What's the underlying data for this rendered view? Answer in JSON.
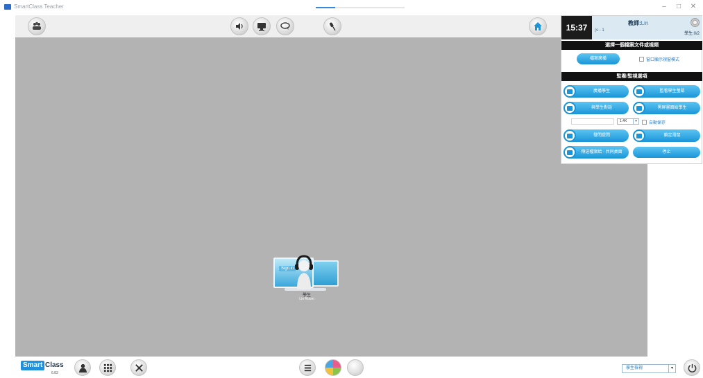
{
  "titlebar": {
    "title": "SmartClass Teacher",
    "progress_fraction": 0.22,
    "minimize": "–",
    "maximize": "□",
    "close": "✕"
  },
  "toolbar": {
    "icons": [
      "students-group-icon",
      "speaker-icon",
      "monitor-icon",
      "chat-icon",
      "microphone-icon",
      "home-icon"
    ]
  },
  "panel": {
    "clock": "15:37",
    "class_id": "(s - 1",
    "teacher_prefix": "教師:",
    "teacher_name": "Lin",
    "student_count": "學生:0/2",
    "section1_title": "選擇一個檔案文件或視頻",
    "open_file_button": "檔案廣播",
    "checkbox_window_mode": "窗口顯示視窗模式",
    "section2_title": "監看/監視選項",
    "buttons": {
      "broadcast_student": "廣播學生",
      "monitor_student_screen": "監看學生螢幕",
      "talk_to_student": "與學生對話",
      "black_screen_student": "黑屏畫面給學生",
      "ask_question": "發問提問",
      "lock_mouse": "鎖定滑鼠",
      "send_ppt": "傳送檔案給 - 共同桌面",
      "stop": "停止"
    },
    "select_small": "1.4K",
    "checkbox_auto_save": "自動保存"
  },
  "student": {
    "screen_label": "Sign in",
    "name": "學生",
    "sub": "Lin Room"
  },
  "bottombar": {
    "logo_smart": "Smart",
    "logo_class": "Class",
    "logo_version": "6.83",
    "icons": [
      "student-profile-icon",
      "grid-layout-icon",
      "tools-icon",
      "list-icon",
      "color-palette-icon",
      "empty-circle-icon"
    ],
    "view_select": "學生檢視",
    "view_select_arrow": "▾",
    "power": "power-icon"
  },
  "colors": {
    "stage": "#b3b3b3",
    "accent": "#1a95d8",
    "panel_header": "#dbe9f2",
    "bar": "#111111"
  }
}
